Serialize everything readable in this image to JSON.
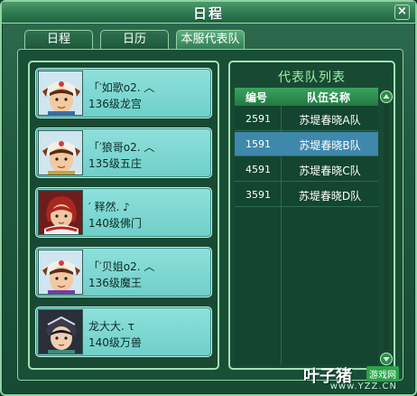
{
  "window": {
    "title": "日程",
    "close_label": "×"
  },
  "tabs": [
    {
      "label": "日程"
    },
    {
      "label": "日历"
    },
    {
      "label": "本服代表队",
      "active": true
    }
  ],
  "members": [
    {
      "name": "「′如歌ο2. ︿",
      "info": "136级龙宫"
    },
    {
      "name": "「′狼哥ο2. ︿",
      "info": "135级五庄"
    },
    {
      "name": "′ 释然. ♪",
      "info": "140级佛门"
    },
    {
      "name": "「′贝姐ο2. ︿",
      "info": "136级魔王"
    },
    {
      "name": "龙大大. τ",
      "info": "140级万兽"
    }
  ],
  "team_list": {
    "title": "代表队列表",
    "headers": {
      "id": "编号",
      "team": "队伍名称"
    },
    "rows": [
      {
        "id": "2591",
        "team": "苏堤春晓A队"
      },
      {
        "id": "1591",
        "team": "苏堤春晓B队",
        "selected": true
      },
      {
        "id": "4591",
        "team": "苏堤春晓C队"
      },
      {
        "id": "3591",
        "team": "苏堤春晓D队"
      }
    ]
  },
  "watermark": {
    "logo": "叶子猪",
    "tag": "游戏网",
    "url": "www.YZZ.CN"
  },
  "colors": {
    "accent_green": "#9ff0a8",
    "selected_row": "#3f88ab",
    "member_card": "#8fe0dc"
  }
}
